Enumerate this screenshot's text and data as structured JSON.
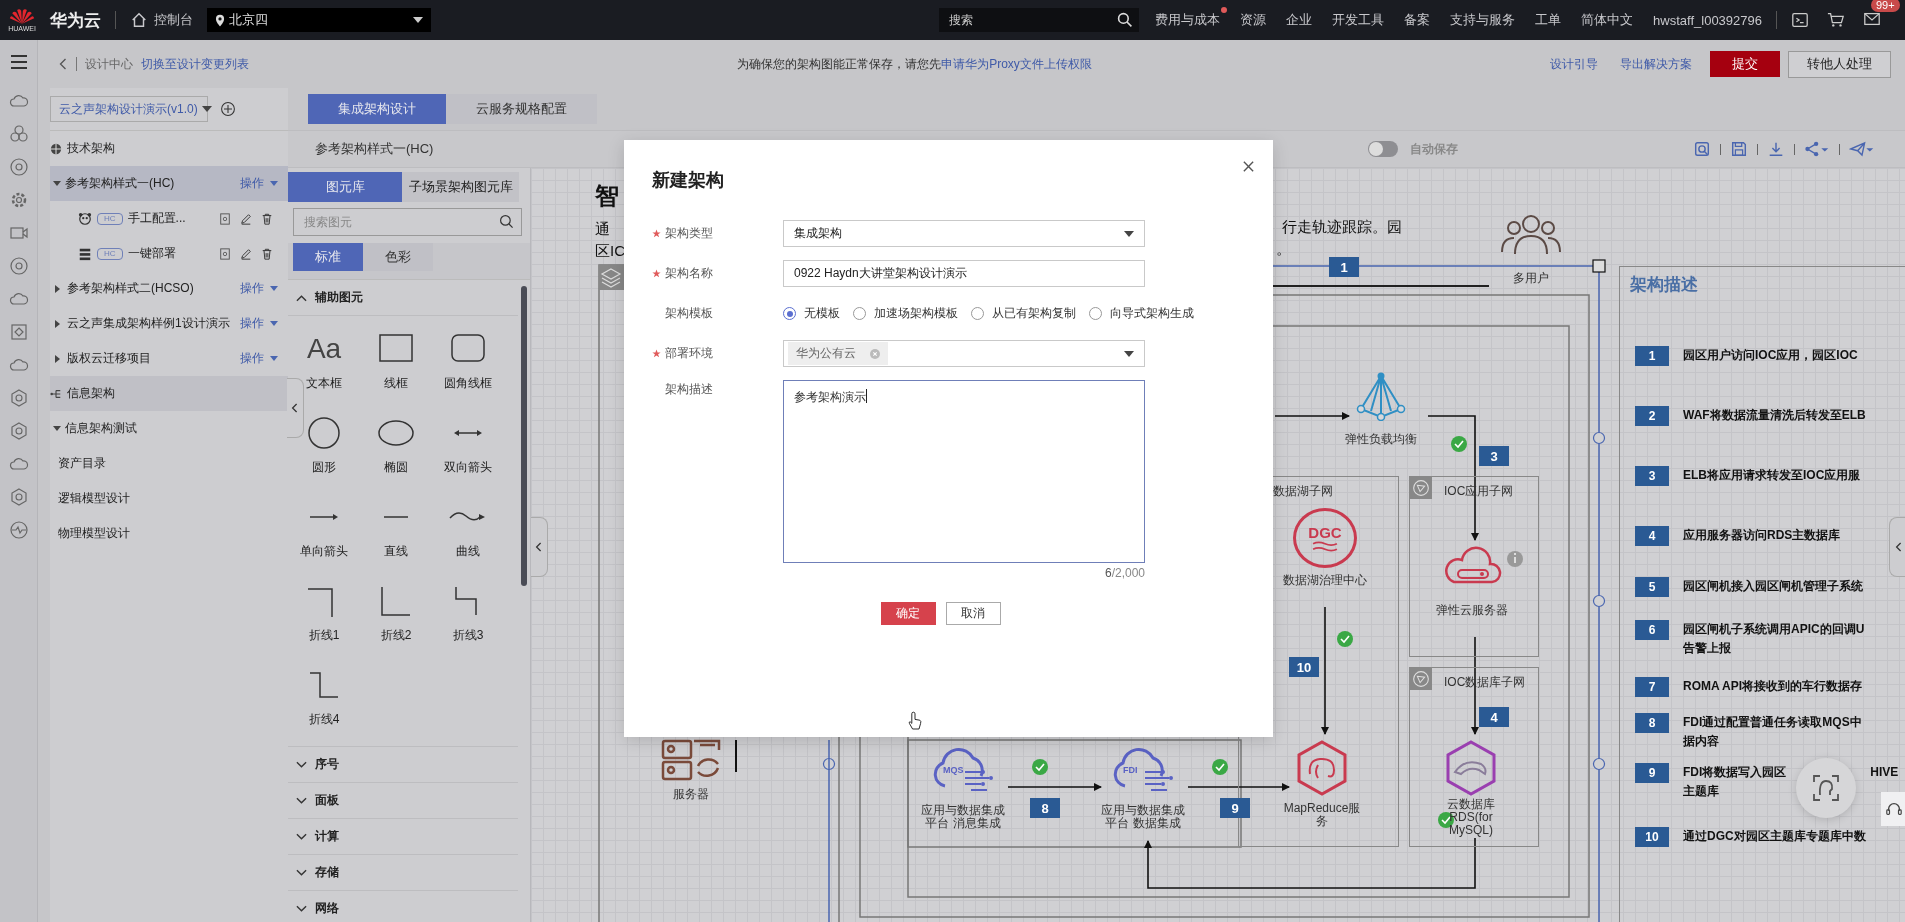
{
  "topbar": {
    "logo_text": "HUAWEI",
    "brand": "华为云",
    "console": "控制台",
    "region": "北京四",
    "search": {
      "placeholder": "搜索"
    },
    "nav": [
      {
        "label": "费用与成本",
        "dot": true
      },
      {
        "label": "资源",
        "dot": false
      },
      {
        "label": "企业",
        "dot": false
      },
      {
        "label": "开发工具",
        "dot": false
      },
      {
        "label": "备案",
        "dot": false
      },
      {
        "label": "支持与服务",
        "dot": false
      },
      {
        "label": "工单",
        "dot": false
      },
      {
        "label": "简体中文",
        "dot": false
      }
    ],
    "user": "hwstaff_l00392796",
    "message_count": "99+"
  },
  "breadcrumb": {
    "parent": "设计中心",
    "link": "切换至设计变更列表",
    "notice": "为确保您的架构图能正常保存，请您先",
    "notice_link": "申请华为Proxy文件上传权限",
    "actions": [
      {
        "label": "设计引导",
        "kind": "link"
      },
      {
        "label": "导出解决方案",
        "kind": "link"
      },
      {
        "label": "提交",
        "kind": "primary"
      },
      {
        "label": "转他人处理",
        "kind": "default"
      }
    ]
  },
  "project_select": {
    "value": "云之声架构设计演示(v1.0)"
  },
  "tree": [
    {
      "label": "技术架构",
      "selected": false,
      "children": [
        {
          "label": "参考架构样式一(HC)",
          "action": "操作",
          "expanded": true,
          "selected": true,
          "children": [
            {
              "kind": "leaf",
              "tag": "HC",
              "label": "手工配置..."
            },
            {
              "kind": "leaf",
              "tag": "HC",
              "label": "一键部署"
            }
          ]
        },
        {
          "label": "参考架构样式二(HCSO)",
          "action": "操作",
          "expanded": false,
          "selected": false
        },
        {
          "label": "云之声集成架构样例1设计演示",
          "action": "操作",
          "expanded": false,
          "selected": false
        },
        {
          "label": "版权云迁移项目",
          "action": "操作",
          "expanded": false,
          "selected": false
        }
      ]
    },
    {
      "label": "信息架构",
      "selected": true,
      "children": [
        {
          "label": "信息架构测试",
          "expanded": true,
          "selected": false,
          "children": [
            {
              "kind": "plain",
              "label": "资产目录"
            },
            {
              "kind": "plain",
              "label": "逻辑模型设计"
            },
            {
              "kind": "plain",
              "label": "物理模型设计"
            }
          ]
        }
      ]
    }
  ],
  "workspace_tabs": [
    {
      "label": "集成架构设计",
      "selected": true
    },
    {
      "label": "云服务规格配置",
      "selected": false
    }
  ],
  "toolbar": {
    "title": "参考架构样式一(HC)",
    "autosave": {
      "label": "自动保存",
      "on": false
    }
  },
  "library": {
    "tabs": [
      {
        "label": "图元库",
        "selected": true
      },
      {
        "label": "子场景架构图元库",
        "selected": false
      }
    ],
    "search": {
      "placeholder": "搜索图元"
    },
    "styles": [
      {
        "label": "标准",
        "selected": true
      },
      {
        "label": "色彩",
        "selected": false
      }
    ],
    "sections": [
      {
        "label": "辅助图元",
        "expanded": true,
        "items": [
          {
            "kind": "text",
            "label": "文本框",
            "glyph": "Aa"
          },
          {
            "kind": "rect",
            "label": "线框"
          },
          {
            "kind": "roundrect",
            "label": "圆角线框"
          },
          {
            "kind": "circle",
            "label": "圆形"
          },
          {
            "kind": "ellipse",
            "label": "椭圆"
          },
          {
            "kind": "double-arrow",
            "label": "双向箭头"
          },
          {
            "kind": "arrow",
            "label": "单向箭头"
          },
          {
            "kind": "line",
            "label": "直线"
          },
          {
            "kind": "curve",
            "label": "曲线"
          },
          {
            "kind": "polyline1",
            "label": "折线1"
          },
          {
            "kind": "polyline2",
            "label": "折线2"
          },
          {
            "kind": "polyline3",
            "label": "折线3"
          },
          {
            "kind": "polyline4",
            "label": "折线4"
          }
        ]
      },
      {
        "label": "序号",
        "expanded": false
      },
      {
        "label": "面板",
        "expanded": false
      },
      {
        "label": "计算",
        "expanded": false
      },
      {
        "label": "存储",
        "expanded": false
      },
      {
        "label": "网络",
        "expanded": false
      }
    ]
  },
  "canvas": {
    "title_fragment": "智",
    "intro_left": [
      "通",
      "区IC"
    ],
    "intro_right": [
      "行走轨迹跟踪。园",
      "。"
    ],
    "groups": [
      {
        "label": "数据湖子网"
      },
      {
        "label": "IOC应用子网"
      },
      {
        "label": "IOC数据库子网"
      }
    ],
    "nodes": [
      {
        "kind": "users",
        "lines": [
          "多用户"
        ]
      },
      {
        "kind": "elb",
        "lines": [
          "弹性负载均衡"
        ]
      },
      {
        "kind": "dgc",
        "lines": [
          "数据湖治理中心"
        ],
        "icon_text": "DGC"
      },
      {
        "kind": "ecs",
        "lines": [
          "弹性云服务器"
        ]
      },
      {
        "kind": "mapreduce",
        "lines": [
          "MapReduce服",
          "务"
        ]
      },
      {
        "kind": "rds",
        "lines": [
          "云数据库",
          "RDS(for",
          "MySQL)"
        ]
      },
      {
        "kind": "server",
        "lines": [
          "服务器"
        ]
      },
      {
        "kind": "mqs",
        "lines": [
          "应用与数据集成",
          "平台 消息集成"
        ],
        "icon_text": "MQS"
      },
      {
        "kind": "fdi",
        "lines": [
          "应用与数据集成",
          "平台 数据集成"
        ],
        "icon_text": "FDI"
      }
    ],
    "steps": [
      "1",
      "3",
      "10",
      "4",
      "8",
      "9"
    ],
    "description": {
      "title": "架构描述",
      "items": [
        {
          "number": "1",
          "lines": [
            "园区用户访问IOC应用，园区IOC"
          ]
        },
        {
          "number": "2",
          "lines": [
            "WAF将数据流量清洗后转发至ELB"
          ]
        },
        {
          "number": "3",
          "lines": [
            "ELB将应用请求转发至IOC应用服"
          ]
        },
        {
          "number": "4",
          "lines": [
            "应用服务器访问RDS主数据库"
          ]
        },
        {
          "number": "5",
          "lines": [
            "园区闸机接入园区闸机管理子系统"
          ]
        },
        {
          "number": "6",
          "lines": [
            "园区闸机子系统调用APIC的回调U",
            "告警上报"
          ]
        },
        {
          "number": "7",
          "lines": [
            "ROMA API将接收到的车行数据存"
          ]
        },
        {
          "number": "8",
          "lines": [
            "FDI通过配置普通任务读取MQS中",
            "据内容"
          ]
        },
        {
          "number": "9",
          "lines": [
            "FDI将数据写入园区",
            "主题库"
          ],
          "tail": "HIVE"
        },
        {
          "number": "10",
          "lines": [
            "通过DGC对园区主题库专题库中数"
          ]
        }
      ]
    }
  },
  "modal": {
    "title": "新建架构",
    "fields": [
      {
        "kind": "select",
        "label": "架构类型",
        "required": true,
        "value": "集成架构"
      },
      {
        "kind": "input",
        "label": "架构名称",
        "required": true,
        "value": "0922 Haydn大讲堂架构设计演示"
      },
      {
        "kind": "radio",
        "label": "架构模板",
        "required": false,
        "options": [
          {
            "label": "无模板",
            "selected": true
          },
          {
            "label": "加速场架构模板",
            "selected": false
          },
          {
            "label": "从已有架构复制",
            "selected": false
          },
          {
            "label": "向导式架构生成",
            "selected": false
          }
        ]
      },
      {
        "kind": "tags",
        "label": "部署环境",
        "required": true,
        "tags": [
          "华为公有云"
        ]
      },
      {
        "kind": "textarea",
        "label": "架构描述",
        "required": false,
        "value": "参考架构演示",
        "count": "6",
        "limit": "/2,000"
      }
    ],
    "buttons": [
      {
        "label": "确定",
        "kind": "primary"
      },
      {
        "label": "取消",
        "kind": "default"
      }
    ]
  }
}
